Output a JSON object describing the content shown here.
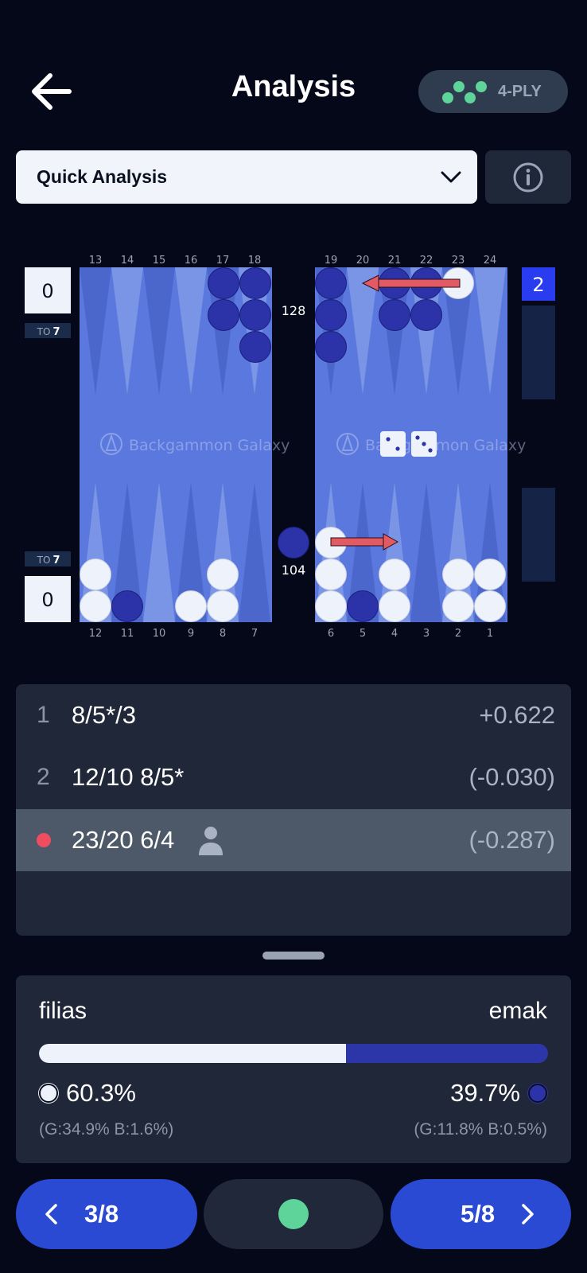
{
  "header": {
    "title": "Analysis",
    "ply_label": "4-PLY"
  },
  "analysis_select": {
    "value": "Quick Analysis"
  },
  "board": {
    "top_point_labels_left": [
      "13",
      "14",
      "15",
      "16",
      "17",
      "18"
    ],
    "top_point_labels_right": [
      "19",
      "20",
      "21",
      "22",
      "23",
      "24"
    ],
    "bottom_point_labels_left": [
      "12",
      "11",
      "10",
      "9",
      "8",
      "7"
    ],
    "bottom_point_labels_right": [
      "6",
      "5",
      "4",
      "3",
      "2",
      "1"
    ],
    "score_top": "0",
    "score_bottom": "0",
    "match_to_top": {
      "prefix": "TO",
      "value": "7"
    },
    "match_to_bottom": {
      "prefix": "TO",
      "value": "7"
    },
    "pip_top": "128",
    "pip_bottom": "104",
    "cube_value": "2",
    "watermark": "Backgammon Galaxy",
    "dice": [
      2,
      3
    ]
  },
  "moves": [
    {
      "rank": "1",
      "move": "8/5*/3",
      "equity": "+0.622",
      "selected": false
    },
    {
      "rank": "2",
      "move": "12/10 8/5*",
      "equity": "(-0.030)",
      "selected": false
    },
    {
      "rank": "",
      "move": "23/20 6/4",
      "equity": "(-0.287)",
      "selected": true,
      "played_by_user": true
    }
  ],
  "win_probability": {
    "player_left": "filias",
    "player_right": "emak",
    "left_win": 0.603,
    "left_pct": "60.3%",
    "right_pct": "39.7%",
    "left_gb": "(G:34.9% B:1.6%)",
    "right_gb": "(G:11.8% B:0.5%)"
  },
  "nav": {
    "prev_label": "3/8",
    "next_label": "5/8"
  },
  "colors": {
    "background": "#050818",
    "board_blue": "#5a78dd",
    "checker_white": "#eef2fb",
    "checker_dark": "#2c33a8",
    "accent_blue": "#2a4ad3",
    "status_green": "#5fd49a",
    "blunder_red": "#ee4d5f"
  }
}
